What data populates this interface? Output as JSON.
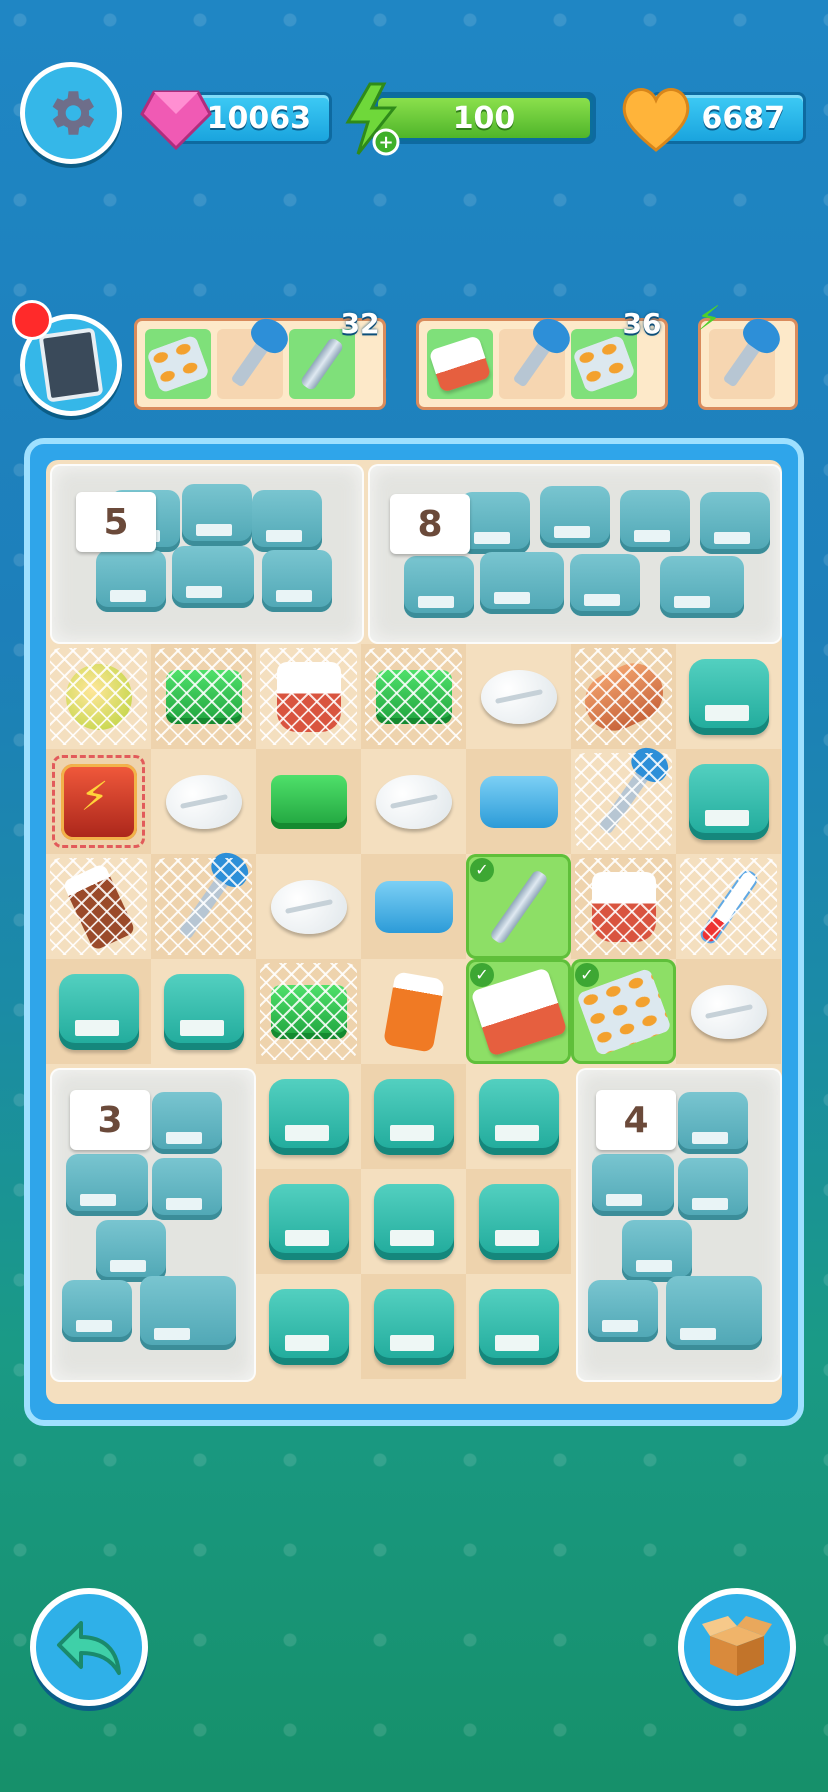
{
  "top_bar": {
    "gems": "10063",
    "energy": "100",
    "energy_fill_pct": 100,
    "hearts": "6687"
  },
  "orders": [
    {
      "items": [
        "blister-pack-icon",
        "spoon-icon",
        "tuning-fork-icon"
      ],
      "done": [
        true,
        false,
        true
      ],
      "badge": "32"
    },
    {
      "items": [
        "bandage-box-icon",
        "spoon-icon",
        "blister-pack-icon"
      ],
      "done": [
        true,
        false,
        true
      ],
      "badge": "36"
    },
    {
      "items": [
        "spoon-icon"
      ],
      "done": [
        false
      ],
      "badge": ""
    }
  ],
  "board": {
    "bag_counts": {
      "top_left": "5",
      "top_right": "8",
      "bottom_left": "3",
      "bottom_right": "4"
    }
  },
  "colors": {
    "accent": "#2fa5ea",
    "board_bg": "#f4dfbf",
    "selected": "#8ddf66",
    "pack": "#1ea99a"
  }
}
